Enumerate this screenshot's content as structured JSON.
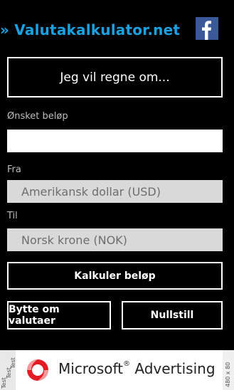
{
  "header": {
    "title": "» Valutakalkulator.net",
    "facebook_icon": "facebook-icon"
  },
  "mode_button_label": "Jeg vil regne om...",
  "amount": {
    "label": "Ønsket beløp",
    "value": ""
  },
  "from": {
    "label": "Fra",
    "selected": "Amerikansk dollar (USD)"
  },
  "to": {
    "label": "Til",
    "selected": "Norsk krone (NOK)"
  },
  "buttons": {
    "calculate": "Kalkuler beløp",
    "swap": "Bytte om valutaer",
    "reset": "Nullstill"
  },
  "ad": {
    "test_labels": [
      "Test",
      "Test",
      "Test"
    ],
    "brand": "Microsoft",
    "product": "Advertising",
    "size": "480 x 80"
  },
  "colors": {
    "accent": "#1ba1e2",
    "facebook": "#3b5998",
    "background": "#000000"
  }
}
